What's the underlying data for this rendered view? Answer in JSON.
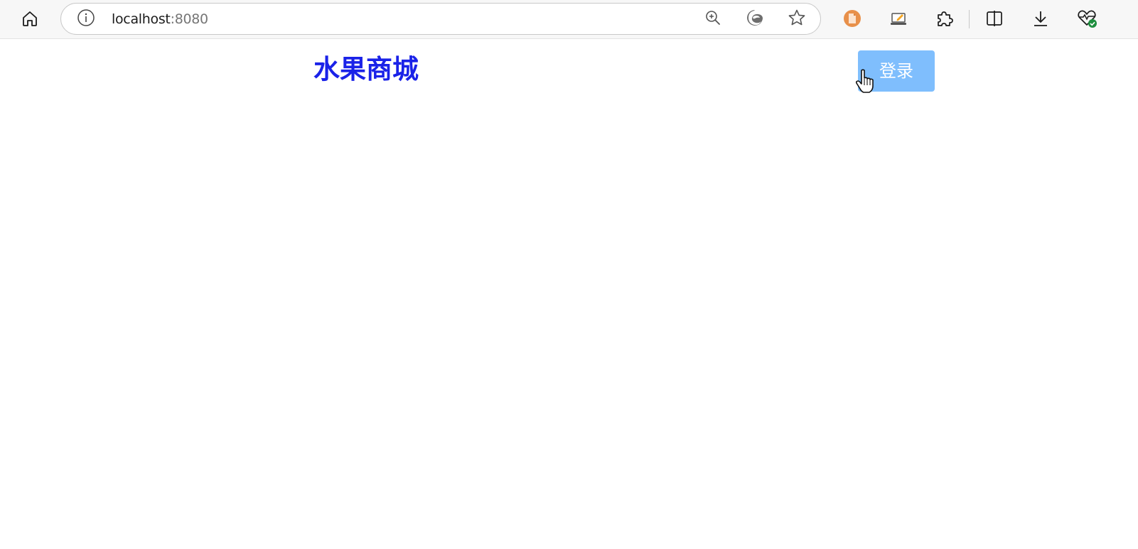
{
  "browser": {
    "address": {
      "host": "localhost",
      "port": ":8080"
    },
    "icons": {
      "home": "home-icon",
      "site_info": "info-circle-icon",
      "zoom": "zoom-in-icon",
      "edge": "edge-logo-icon",
      "favorite": "star-outline-icon",
      "extension_1": "document-extension-icon",
      "extension_2": "laptop-pen-extension-icon",
      "extensions": "puzzle-piece-icon",
      "split_screen": "split-screen-icon",
      "downloads": "download-arrow-icon",
      "browser_essentials": "heart-pulse-check-icon"
    },
    "colors": {
      "toolbar_bg": "#f7f7f7",
      "extension_1_accent": "#e8904a",
      "extension_2_accent": "#f5a623",
      "health_check": "#1e8e3e"
    }
  },
  "page": {
    "title": "水果商城",
    "login_label": "登录",
    "colors": {
      "title": "#1a22e8",
      "login_bg": "#7fbefd",
      "login_text": "#ffffff"
    }
  },
  "cursor": {
    "type": "hand-pointer-icon"
  }
}
